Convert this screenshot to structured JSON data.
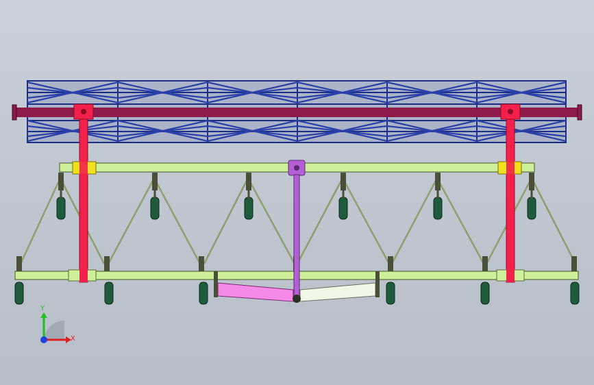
{
  "colors": {
    "background_top": "#c9d0d9",
    "background_bottom": "#b7bec8",
    "roller_cage": "#1c2d86",
    "roller_shaft": "#8e1a4b",
    "vertical_posts": "#f2204a",
    "frame_beams": "#cff09a",
    "frame_beam_edge": "#5c6b3a",
    "brackets": "#f0e020",
    "center_link": "#b45fd6",
    "drawbar_left": "#f58ae8",
    "drawbar_right": "#f1f7e6",
    "tines": "#1e5a3c",
    "braces": "#5e6a36",
    "axis_x": "#e02020",
    "axis_y": "#20c020",
    "axis_z": "#2040e0"
  },
  "triad": {
    "x_label": "X",
    "y_label": "Y"
  },
  "icons": {
    "triad": "coordinate-triad-icon"
  }
}
